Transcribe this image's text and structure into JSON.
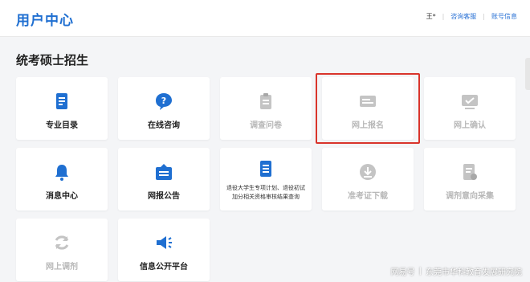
{
  "header": {
    "title": "用户中心",
    "user": "王*",
    "links": [
      "咨询客服",
      "账号信息"
    ]
  },
  "section_title": "统考硕士招生",
  "colors": {
    "accent": "#1f6fd1",
    "disabled": "#c4c4c4",
    "highlight": "#d9342b"
  },
  "tiles": [
    {
      "label": "专业目录",
      "icon": "catalog-icon",
      "enabled": true
    },
    {
      "label": "在线咨询",
      "icon": "chat-question-icon",
      "enabled": true
    },
    {
      "label": "调查问卷",
      "icon": "clipboard-icon",
      "enabled": false
    },
    {
      "label": "网上报名",
      "icon": "card-icon",
      "enabled": false
    },
    {
      "label": "网上确认",
      "icon": "check-screen-icon",
      "enabled": false
    },
    {
      "label": "消息中心",
      "icon": "bell-icon",
      "enabled": true
    },
    {
      "label": "网报公告",
      "icon": "notice-board-icon",
      "enabled": true
    },
    {
      "label": "退役大学生专项计划、退役初试加分相关资格审核结果查询",
      "icon": "document-icon",
      "enabled": true
    },
    {
      "label": "准考证下载",
      "icon": "download-icon",
      "enabled": false
    },
    {
      "label": "调剂意向采集",
      "icon": "form-icon",
      "enabled": false
    },
    {
      "label": "网上调剂",
      "icon": "refresh-icon",
      "enabled": false
    },
    {
      "label": "信息公开平台",
      "icon": "megaphone-icon",
      "enabled": true
    }
  ],
  "watermark": {
    "source": "网易号",
    "author": "东莞市华科教育发展研究院"
  }
}
